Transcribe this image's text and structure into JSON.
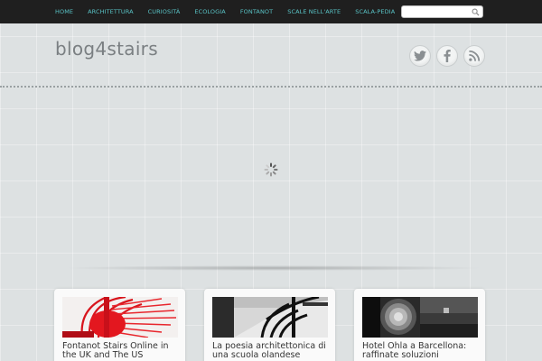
{
  "nav": {
    "items": [
      {
        "label": "HOME"
      },
      {
        "label": "ARCHITETTURA"
      },
      {
        "label": "CURIOSITÀ"
      },
      {
        "label": "ECOLOGIA"
      },
      {
        "label": "FONTANOT"
      },
      {
        "label": "SCALE NELL'ARTE"
      },
      {
        "label": "SCALA-PEDIA"
      }
    ],
    "nav_color": "#59c3c6"
  },
  "search": {
    "placeholder": "",
    "value": ""
  },
  "header": {
    "logo_text": "blog4stairs"
  },
  "social": {
    "icons": [
      "twitter-icon",
      "facebook-icon",
      "rss-icon"
    ]
  },
  "posts": [
    {
      "title": "Fontanot Stairs Online in the UK and The US"
    },
    {
      "title": "La poesia architettonica di una scuola olandese"
    },
    {
      "title": "Hotel Ohla a Barcellona: raffinate soluzioni"
    }
  ]
}
